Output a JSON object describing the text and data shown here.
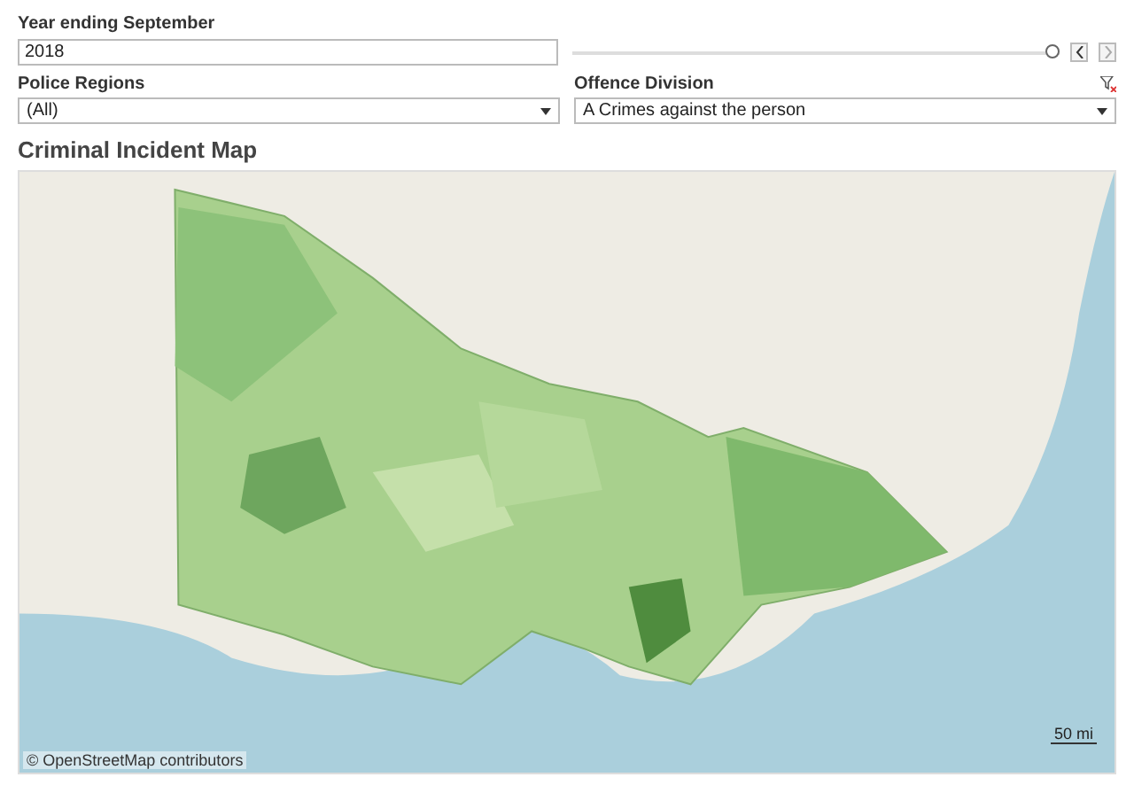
{
  "year_filter": {
    "label": "Year ending September",
    "value": "2018",
    "level": 1
  },
  "police_regions": {
    "label": "Police Regions",
    "value": "(All)"
  },
  "offence_division": {
    "label": "Offence Division",
    "value": "A Crimes against the person"
  },
  "map": {
    "title": "Criminal Incident Map",
    "attribution": "© OpenStreetMap contributors",
    "scale": "50 mi"
  }
}
